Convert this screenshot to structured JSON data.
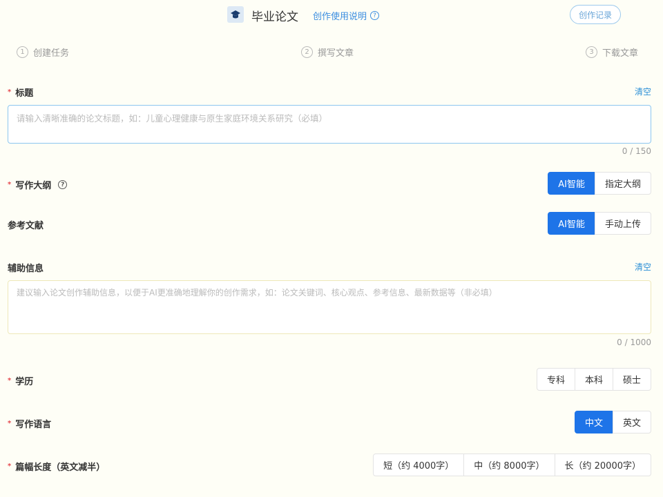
{
  "header": {
    "title": "毕业论文",
    "help_link": "创作使用说明",
    "record_button": "创作记录"
  },
  "steps": [
    {
      "num": "1",
      "label": "创建任务"
    },
    {
      "num": "2",
      "label": "撰写文章"
    },
    {
      "num": "3",
      "label": "下载文章"
    }
  ],
  "title_field": {
    "label": "标题",
    "clear": "清空",
    "placeholder": "请输入清晰准确的论文标题，如：儿童心理健康与原生家庭环境关系研究（必填）",
    "count": "0 / 150"
  },
  "outline": {
    "label": "写作大纲",
    "options": [
      "AI智能",
      "指定大纲"
    ],
    "selected": "AI智能"
  },
  "references": {
    "label": "参考文献",
    "options": [
      "AI智能",
      "手动上传"
    ],
    "selected": "AI智能"
  },
  "aux": {
    "label": "辅助信息",
    "clear": "清空",
    "placeholder": "建议输入论文创作辅助信息，以便于AI更准确地理解你的创作需求，如：论文关键词、核心观点、参考信息、最新数据等（非必填）",
    "count": "0 / 1000"
  },
  "degree": {
    "label": "学历",
    "options": [
      "专科",
      "本科",
      "硕士"
    ]
  },
  "language": {
    "label": "写作语言",
    "options": [
      "中文",
      "英文"
    ],
    "selected": "中文"
  },
  "length": {
    "label": "篇幅长度（英文减半）",
    "options": [
      "短（约 4000字）",
      "中（约 8000字）",
      "长（约 20000字）"
    ]
  },
  "colors": {
    "accent": "#1e74e8",
    "link": "#2b8fd6",
    "required": "#e5484d"
  }
}
